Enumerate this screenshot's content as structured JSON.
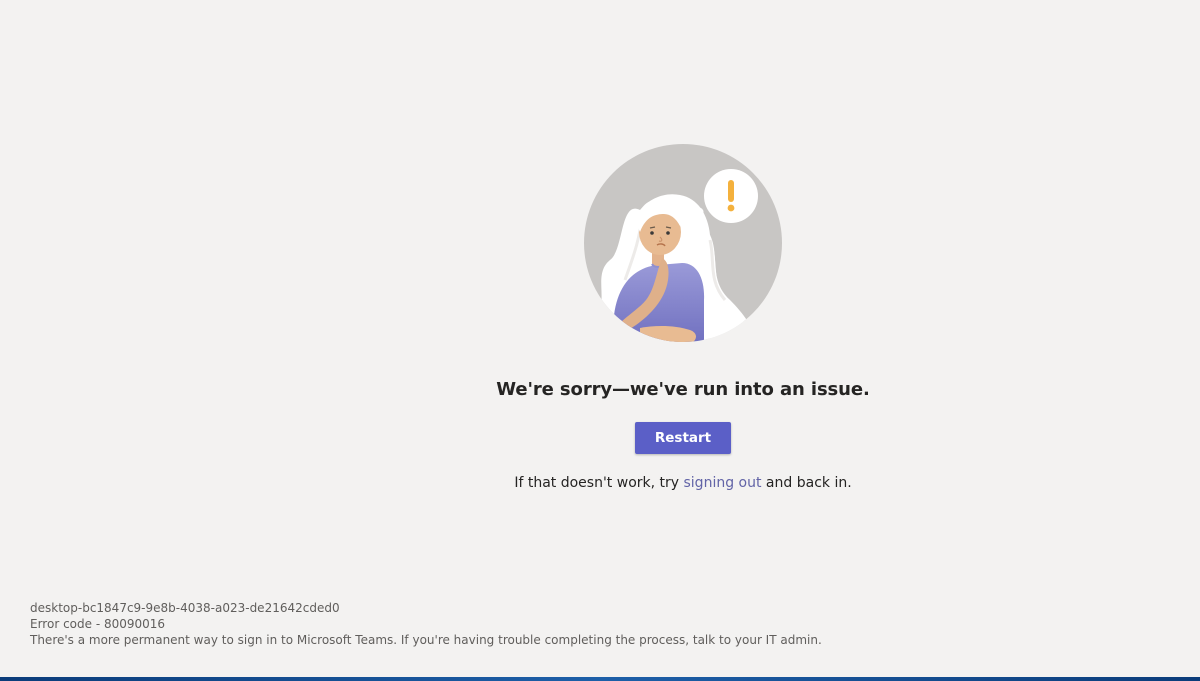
{
  "error_page": {
    "title": "We're sorry—we've run into an issue.",
    "restart_label": "Restart",
    "hint_before": "If that doesn't work, try ",
    "hint_link": "signing out",
    "hint_after": " and back in."
  },
  "footer": {
    "session_id": "desktop-bc1847c9-9e8b-4038-a023-de21642cded0",
    "error_code": "Error code - 80090016",
    "info": "There's a more permanent way to sign in to Microsoft Teams. If you're having trouble completing the process, talk to your IT admin."
  },
  "colors": {
    "background": "#f3f2f1",
    "accent": "#5b5fc7",
    "link": "#6264a7"
  },
  "icons": {
    "illustration": "confused-woman-illustration",
    "thought": "exclamation-icon"
  }
}
